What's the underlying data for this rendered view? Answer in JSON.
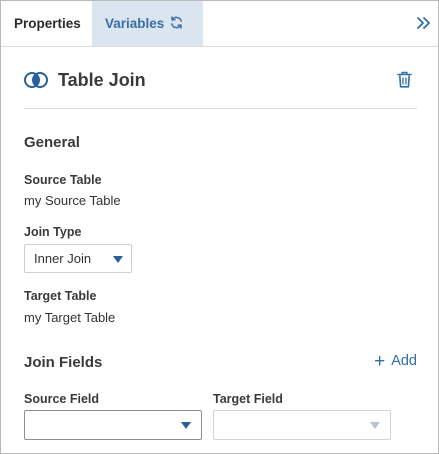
{
  "tabs": {
    "properties": "Properties",
    "variables": "Variables"
  },
  "node": {
    "title": "Table Join"
  },
  "general": {
    "heading": "General",
    "source_table_label": "Source Table",
    "source_table_value": "my Source Table",
    "join_type_label": "Join Type",
    "join_type_value": "Inner Join",
    "target_table_label": "Target Table",
    "target_table_value": "my Target Table"
  },
  "join_fields": {
    "heading": "Join Fields",
    "add_label": "Add",
    "source_field_label": "Source Field",
    "source_field_value": "",
    "target_field_label": "Target Field",
    "target_field_value": ""
  },
  "icons": {
    "refresh": "refresh-icon",
    "collapse": "double-chevron-right-icon",
    "join": "venn-join-icon",
    "delete": "trash-icon",
    "add": "plus-icon"
  },
  "colors": {
    "accent": "#2f6ea7",
    "tab_active_bg": "#dbe5ef",
    "text": "#3a3a3a",
    "disabled_caret": "#b9c3cf"
  }
}
